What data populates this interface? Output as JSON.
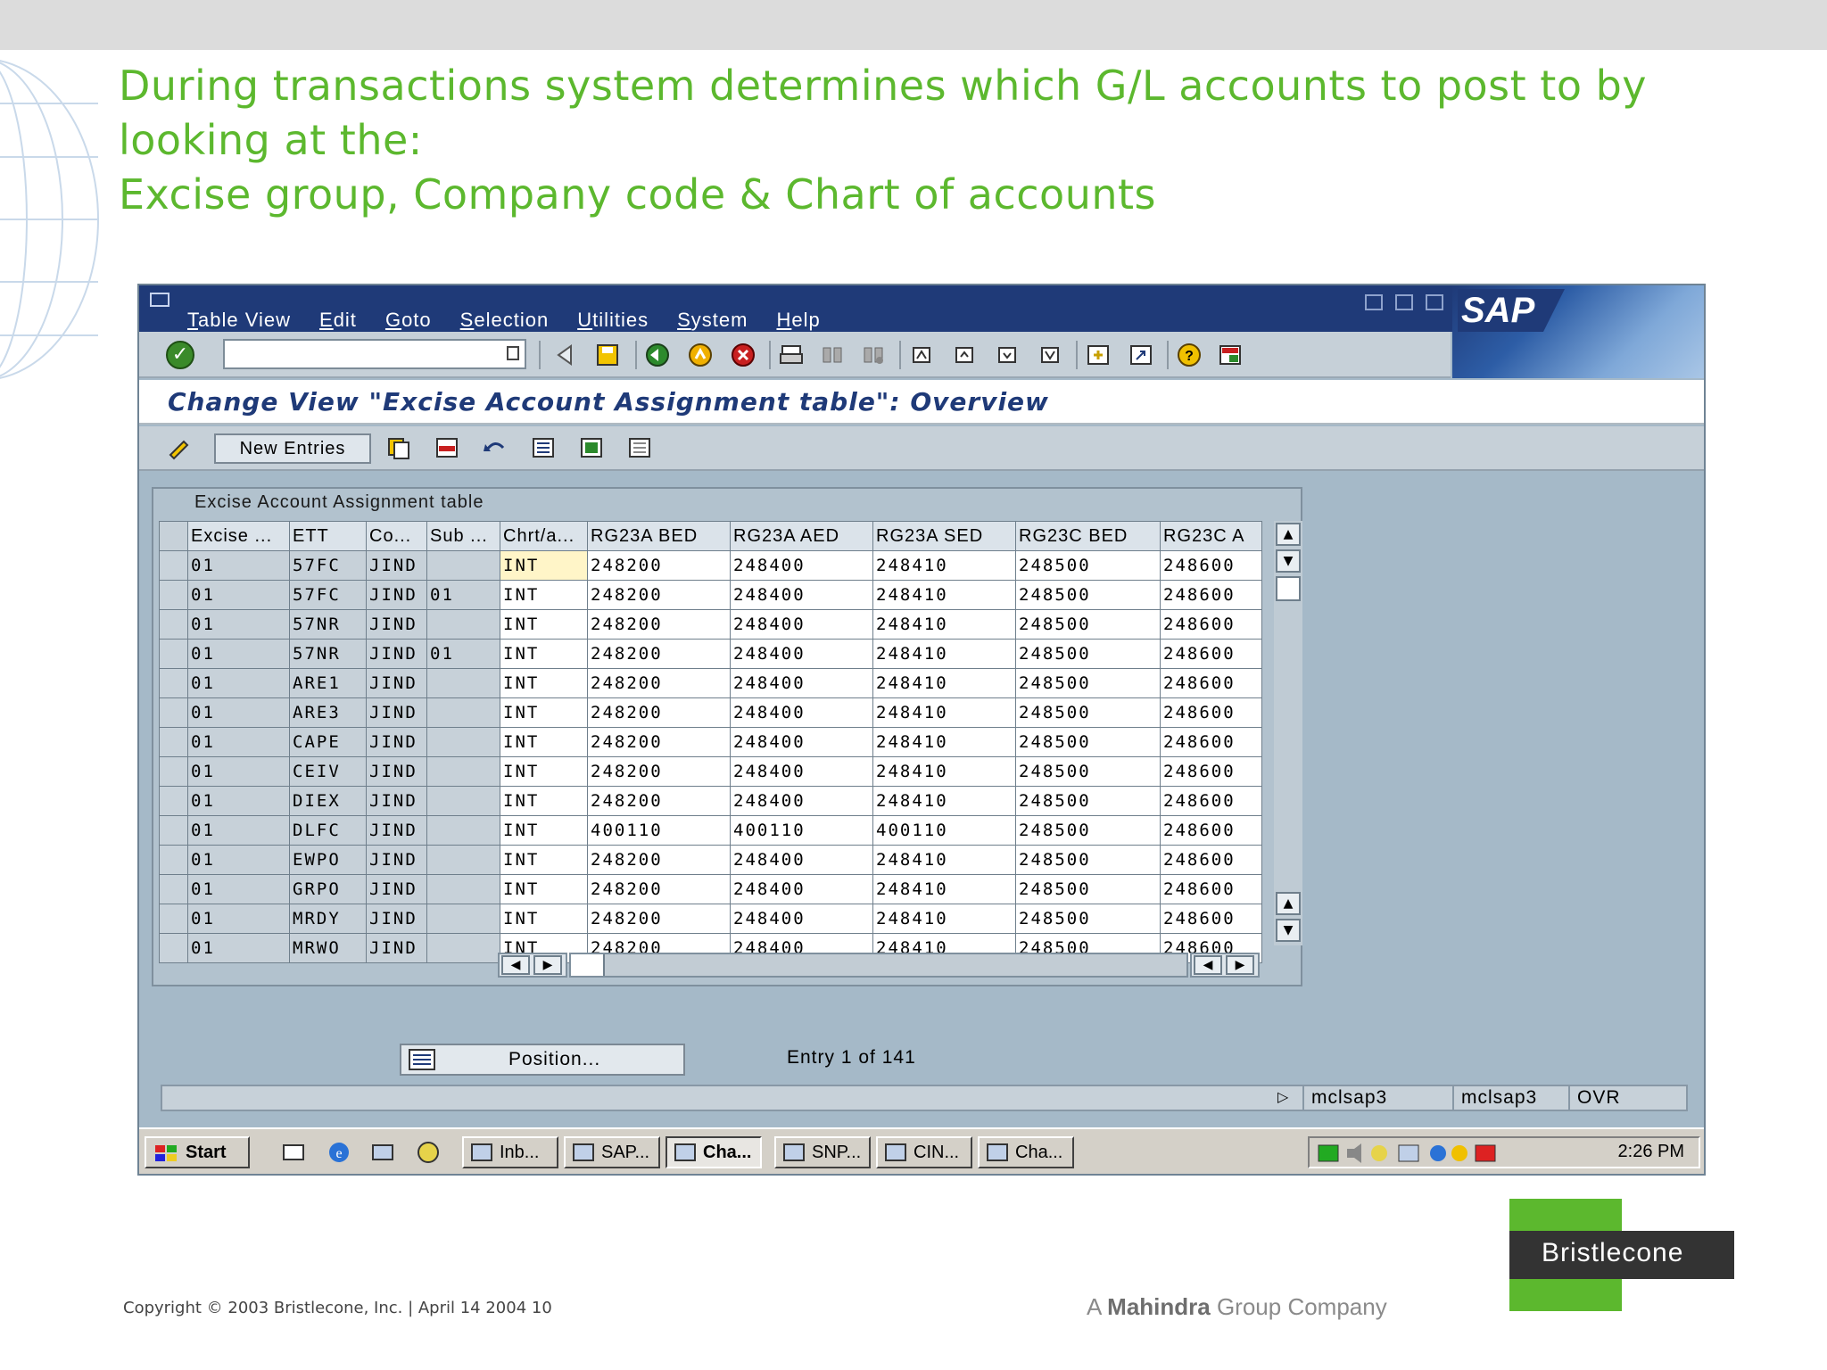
{
  "slide": {
    "title_lines": [
      "During transactions system determines  which G/L accounts to post to by",
      "looking at the:",
      "Excise group, Company code & Chart of accounts"
    ],
    "copyright": "Copyright © 2003 Bristlecone, Inc. |  April 14  2004 10",
    "tagline_prefix": "A",
    "tagline_brand": "Mahindra",
    "tagline_suffix": " Group Company",
    "logo_text": "Bristlecone"
  },
  "sap": {
    "brand": "SAP",
    "menu": [
      "Table View",
      "Edit",
      "Goto",
      "Selection",
      "Utilities",
      "System",
      "Help"
    ],
    "command_field": {
      "value": "",
      "placeholder": ""
    },
    "screen_title": "Change View \"Excise Account Assignment table\": Overview",
    "app_toolbar": {
      "new_entries": "New Entries"
    },
    "table": {
      "caption": "Excise Account Assignment table",
      "headers": [
        "Excise ...",
        "ETT",
        "Co...",
        "Sub ...",
        "Chrt/a...",
        "RG23A BED",
        "RG23A AED",
        "RG23A SED",
        "RG23C BED",
        "RG23C A"
      ],
      "rows": [
        [
          "01",
          "57FC",
          "JIND",
          "",
          "INT",
          "248200",
          "248400",
          "248410",
          "248500",
          "248600"
        ],
        [
          "01",
          "57FC",
          "JIND",
          "01",
          "INT",
          "248200",
          "248400",
          "248410",
          "248500",
          "248600"
        ],
        [
          "01",
          "57NR",
          "JIND",
          "",
          "INT",
          "248200",
          "248400",
          "248410",
          "248500",
          "248600"
        ],
        [
          "01",
          "57NR",
          "JIND",
          "01",
          "INT",
          "248200",
          "248400",
          "248410",
          "248500",
          "248600"
        ],
        [
          "01",
          "ARE1",
          "JIND",
          "",
          "INT",
          "248200",
          "248400",
          "248410",
          "248500",
          "248600"
        ],
        [
          "01",
          "ARE3",
          "JIND",
          "",
          "INT",
          "248200",
          "248400",
          "248410",
          "248500",
          "248600"
        ],
        [
          "01",
          "CAPE",
          "JIND",
          "",
          "INT",
          "248200",
          "248400",
          "248410",
          "248500",
          "248600"
        ],
        [
          "01",
          "CEIV",
          "JIND",
          "",
          "INT",
          "248200",
          "248400",
          "248410",
          "248500",
          "248600"
        ],
        [
          "01",
          "DIEX",
          "JIND",
          "",
          "INT",
          "248200",
          "248400",
          "248410",
          "248500",
          "248600"
        ],
        [
          "01",
          "DLFC",
          "JIND",
          "",
          "INT",
          "400110",
          "400110",
          "400110",
          "248500",
          "248600"
        ],
        [
          "01",
          "EWPO",
          "JIND",
          "",
          "INT",
          "248200",
          "248400",
          "248410",
          "248500",
          "248600"
        ],
        [
          "01",
          "GRPO",
          "JIND",
          "",
          "INT",
          "248200",
          "248400",
          "248410",
          "248500",
          "248600"
        ],
        [
          "01",
          "MRDY",
          "JIND",
          "",
          "INT",
          "248200",
          "248400",
          "248410",
          "248500",
          "248600"
        ],
        [
          "01",
          "MRWO",
          "JIND",
          "",
          "INT",
          "248200",
          "248400",
          "248410",
          "248500",
          "248600"
        ]
      ]
    },
    "position_button": "Position...",
    "entry_info": "Entry 1  of 141",
    "status": {
      "server": "mclsap3",
      "client": "mclsap3",
      "mode": "OVR"
    },
    "taskbar": {
      "start": "Start",
      "tasks": [
        {
          "label": "Inb...",
          "active": false
        },
        {
          "label": "SAP...",
          "active": false
        },
        {
          "label": "Cha...",
          "active": true
        },
        {
          "label": "SNP...",
          "active": false
        },
        {
          "label": "CIN...",
          "active": false
        },
        {
          "label": "Cha...",
          "active": false
        }
      ],
      "clock": "2:26 PM"
    }
  },
  "colors": {
    "title_green": "#5cb82e",
    "sap_blue": "#1f3a78",
    "window_bg": "#a5b9c8"
  }
}
